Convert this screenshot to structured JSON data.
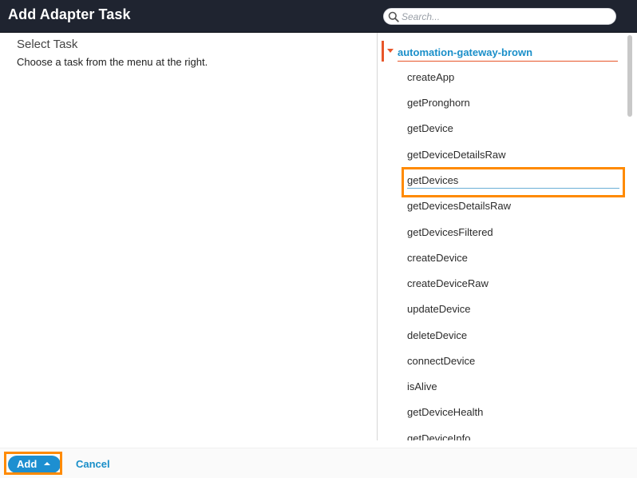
{
  "dialog": {
    "title": "Add Adapter Task"
  },
  "search": {
    "placeholder": "Search...",
    "value": "",
    "icon": "search-icon"
  },
  "left_pane": {
    "heading": "Select Task",
    "instructions": "Choose a task from the menu at the right."
  },
  "task_tree": {
    "group": {
      "label": "automation-gateway-brown",
      "expanded": true,
      "icon": "chevron-down-icon"
    },
    "selected_index": 4,
    "items": [
      "createApp",
      "getPronghorn",
      "getDevice",
      "getDeviceDetailsRaw",
      "getDevices",
      "getDevicesDetailsRaw",
      "getDevicesFiltered",
      "createDevice",
      "createDeviceRaw",
      "updateDevice",
      "deleteDevice",
      "connectDevice",
      "isAlive",
      "getDeviceHealth",
      "getDeviceInfo"
    ]
  },
  "footer": {
    "add_label": "Add",
    "add_icon": "caret-up-icon",
    "cancel_label": "Cancel"
  },
  "colors": {
    "titlebar": "#1f2430",
    "accent_blue": "#1d8fd1",
    "link_blue": "#1a8fc9",
    "tree_accent": "#e8562a",
    "highlight": "#ff8a00"
  }
}
